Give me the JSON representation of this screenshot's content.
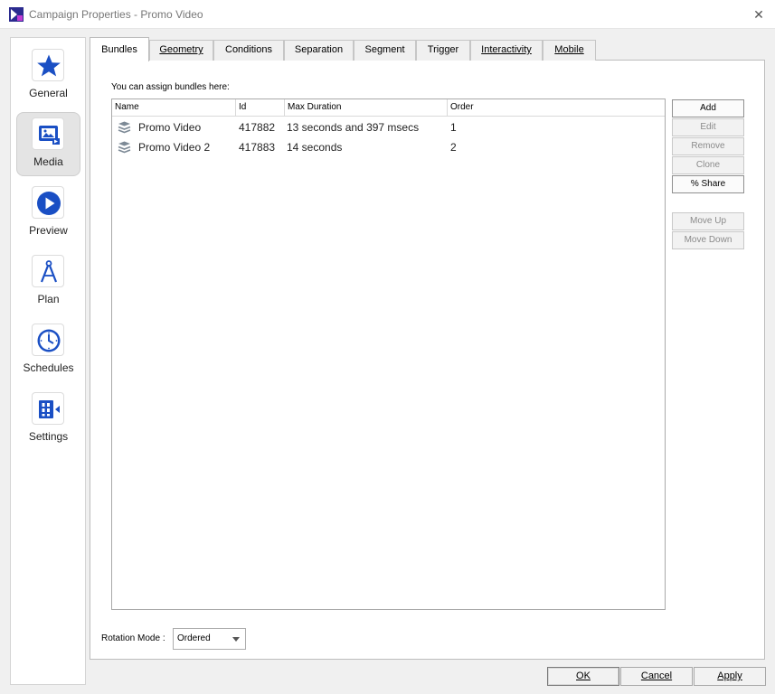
{
  "window": {
    "title": "Campaign Properties - Promo Video",
    "icon": "app-logo-icon",
    "close_label": "✕"
  },
  "sidebar": {
    "items": [
      {
        "label": "General",
        "icon": "star-icon"
      },
      {
        "label": "Media",
        "icon": "media-icon",
        "active": true
      },
      {
        "label": "Preview",
        "icon": "play-icon"
      },
      {
        "label": "Plan",
        "icon": "compass-icon"
      },
      {
        "label": "Schedules",
        "icon": "clock-icon"
      },
      {
        "label": "Settings",
        "icon": "settings-icon"
      }
    ]
  },
  "tabs": [
    {
      "label": "Bundles",
      "active": true
    },
    {
      "label": "Geometry"
    },
    {
      "label": "Conditions"
    },
    {
      "label": "Separation"
    },
    {
      "label": "Segment"
    },
    {
      "label": "Trigger"
    },
    {
      "label": "Interactivity"
    },
    {
      "label": "Mobile"
    }
  ],
  "bundles": {
    "hint": "You can assign bundles here:",
    "columns": [
      "Name",
      "Id",
      "Max Duration",
      "Order"
    ],
    "rows": [
      {
        "name": "Promo Video",
        "id": "417882",
        "duration": "13 seconds and 397 msecs",
        "order": "1"
      },
      {
        "name": "Promo Video 2",
        "id": "417883",
        "duration": "14 seconds",
        "order": "2"
      }
    ]
  },
  "actions": {
    "add": "Add",
    "edit": "Edit",
    "remove": "Remove",
    "clone": "Clone",
    "share": "% Share",
    "move_up": "Move Up",
    "move_down": "Move Down"
  },
  "rotation": {
    "label": "Rotation Mode :",
    "value": "Ordered"
  },
  "dialog_buttons": {
    "ok": "OK",
    "cancel": "Cancel",
    "apply": "Apply"
  },
  "colors": {
    "accent_blue": "#1a4fc4",
    "icon_blue": "#1a4fc4"
  }
}
